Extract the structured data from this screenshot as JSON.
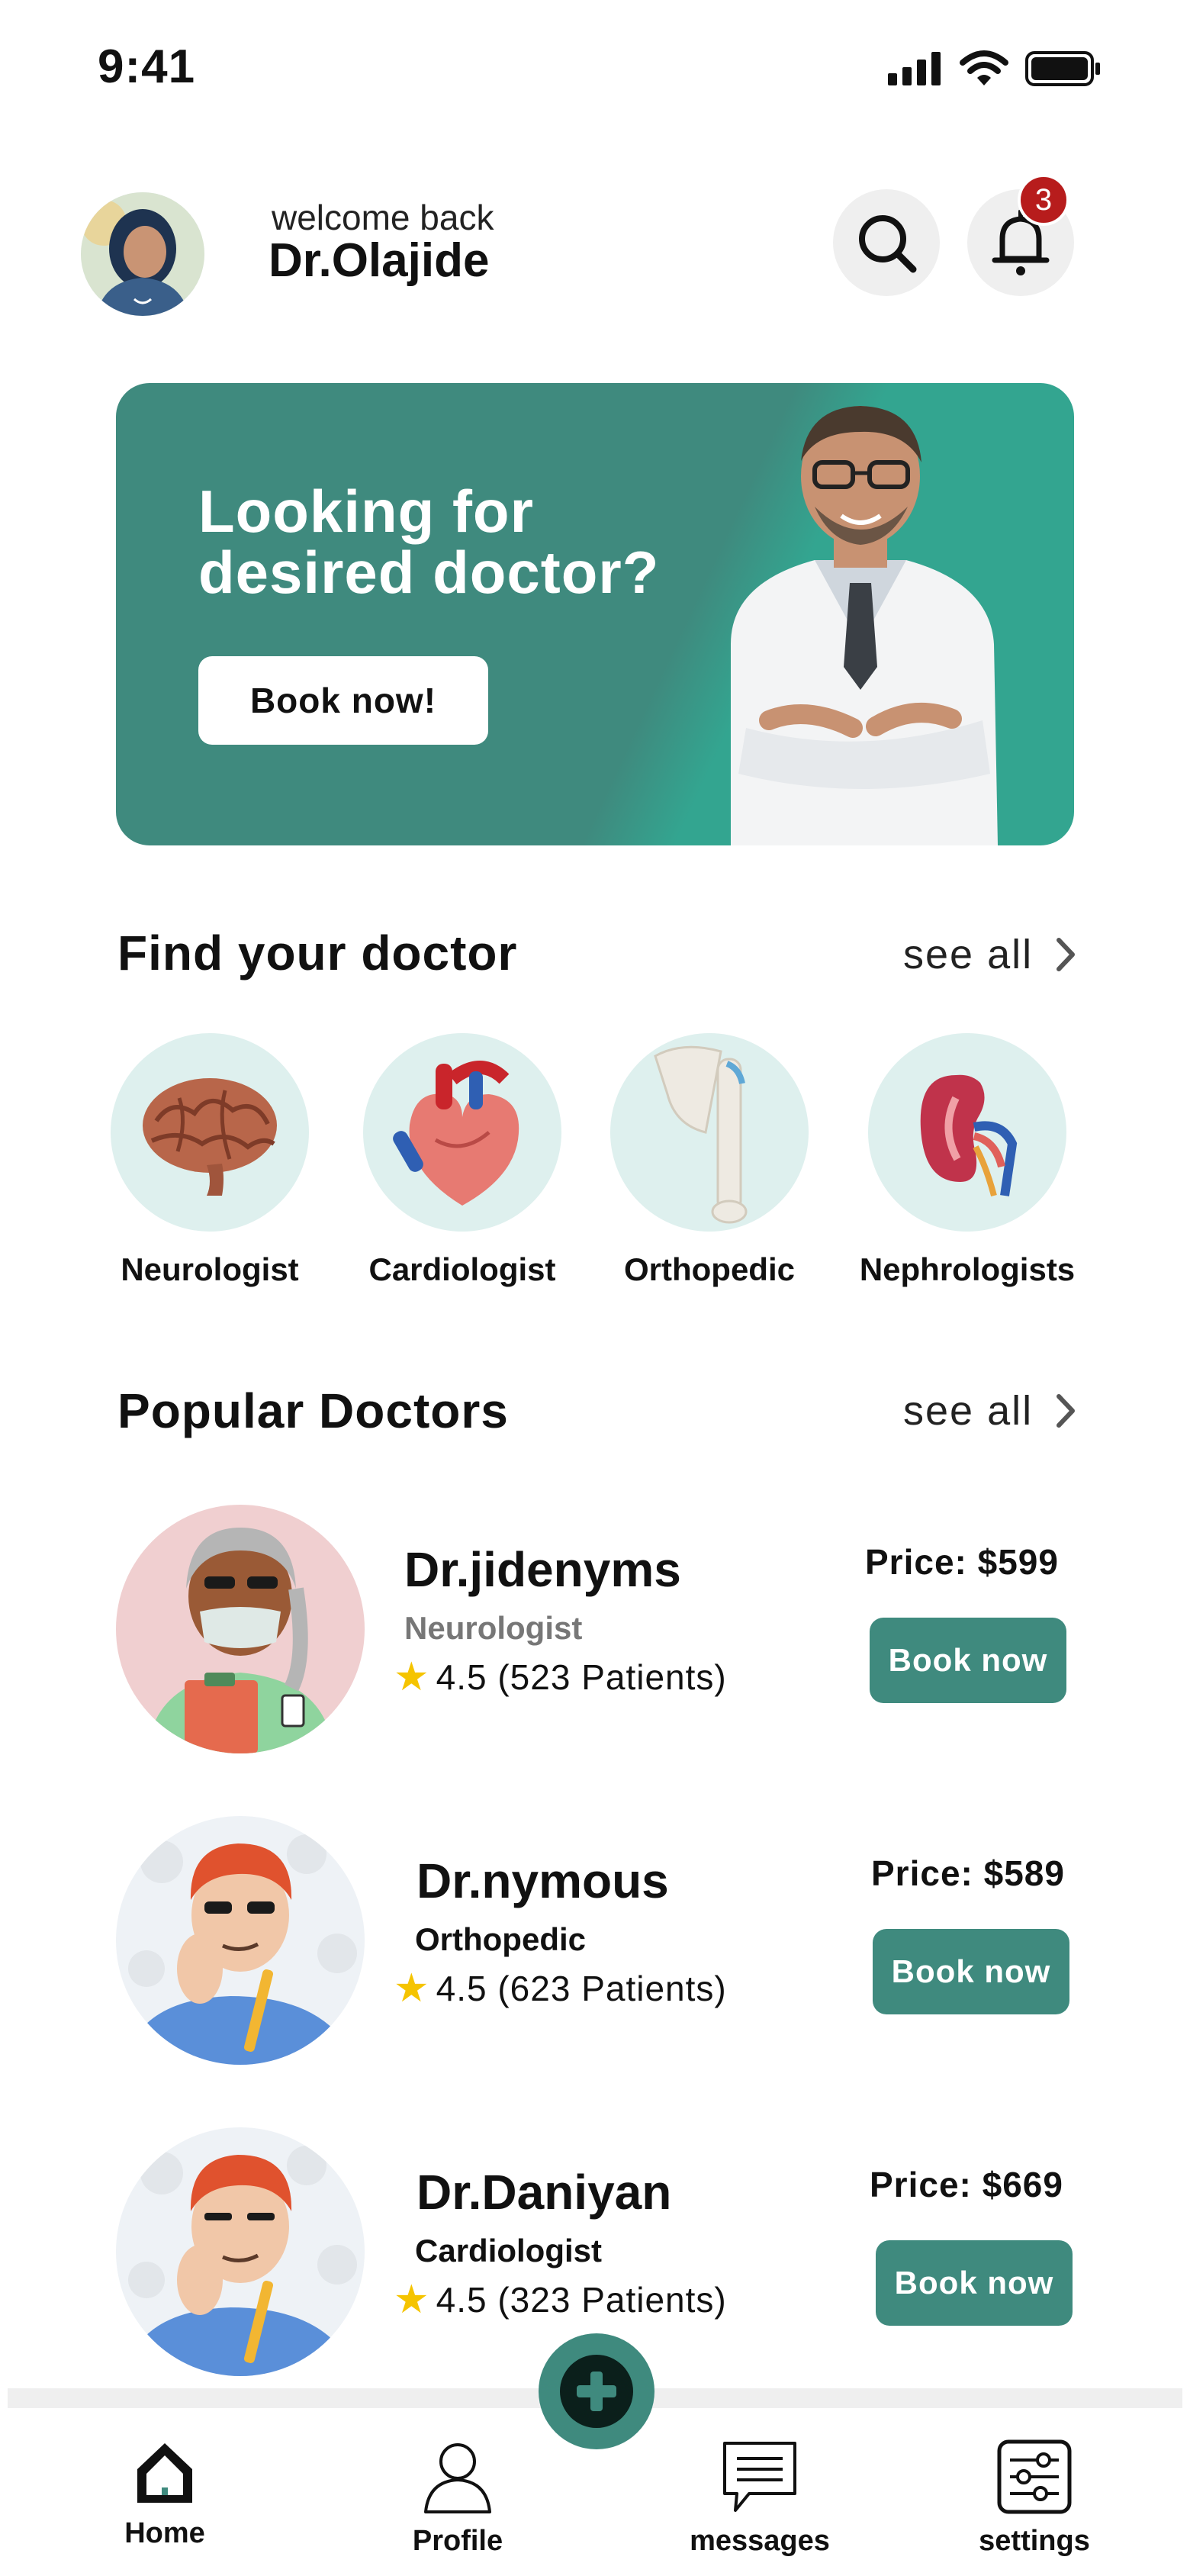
{
  "status_bar": {
    "time": "9:41",
    "icons": [
      "signal-icon",
      "wifi-icon",
      "battery-icon"
    ]
  },
  "header": {
    "welcome": "welcome back",
    "user_name": "Dr.Olajide",
    "notification_count": "3",
    "icons": [
      "search-icon",
      "bell-icon"
    ]
  },
  "banner": {
    "title_line1": "Looking for",
    "title_line2": "desired doctor?",
    "button": "Book now!"
  },
  "find_doctor": {
    "title": "Find your doctor",
    "see_all": "see all",
    "specialties": [
      {
        "label": "Neurologist",
        "icon": "brain-icon"
      },
      {
        "label": "Cardiologist",
        "icon": "heart-icon"
      },
      {
        "label": "Orthopedic",
        "icon": "bone-icon"
      },
      {
        "label": "Nephrologists",
        "icon": "kidney-icon"
      }
    ]
  },
  "popular": {
    "title": "Popular Doctors",
    "see_all": "see all",
    "doctors": [
      {
        "name": "Dr.jidenyms",
        "specialty": "Neurologist",
        "rating": "4.5 (523 Patients)",
        "price": "Price: $599",
        "book": "Book now"
      },
      {
        "name": "Dr.nymous",
        "specialty": "Orthopedic",
        "rating": "4.5 (623 Patients)",
        "price": "Price: $589",
        "book": "Book now"
      },
      {
        "name": "Dr.Daniyan",
        "specialty": "Cardiologist",
        "rating": "4.5 (323 Patients)",
        "price": "Price: $669",
        "book": "Book now"
      }
    ]
  },
  "bottom_nav": {
    "items": [
      {
        "label": "Home",
        "icon": "home-icon"
      },
      {
        "label": "Profile",
        "icon": "profile-icon"
      },
      {
        "label": "messages",
        "icon": "message-icon"
      },
      {
        "label": "settings",
        "icon": "settings-icon"
      }
    ],
    "fab_icon": "plus-icon"
  },
  "colors": {
    "accent": "#3f8a7e",
    "accent_light": "#33a590",
    "circle_bg": "#def0ee",
    "badge": "#b71c1c",
    "star": "#f5c400",
    "muted_specialty": "#777777"
  }
}
